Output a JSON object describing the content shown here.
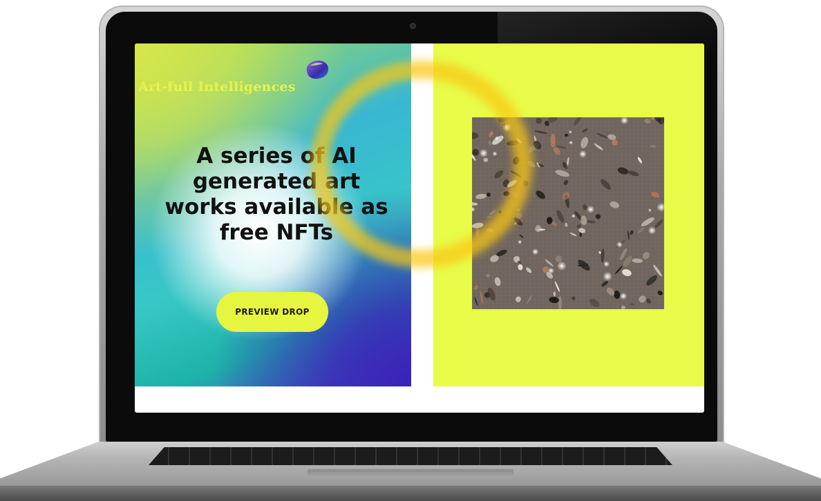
{
  "site": {
    "brand_name": "Art-full Intelligences",
    "logo_icon": "blob-logo-icon"
  },
  "hero": {
    "headline": "A series of AI generated art works available as free NFTs",
    "cta_label": "PREVIEW DROP"
  },
  "artwork": {
    "icon": "ai-artwork-image"
  },
  "colors": {
    "accent_yellow": "#e8fb48",
    "button_yellow": "#e6f53f",
    "headline_text": "#111111",
    "brand_text": "#e9f24a",
    "ring_glow": "#f7c414"
  }
}
